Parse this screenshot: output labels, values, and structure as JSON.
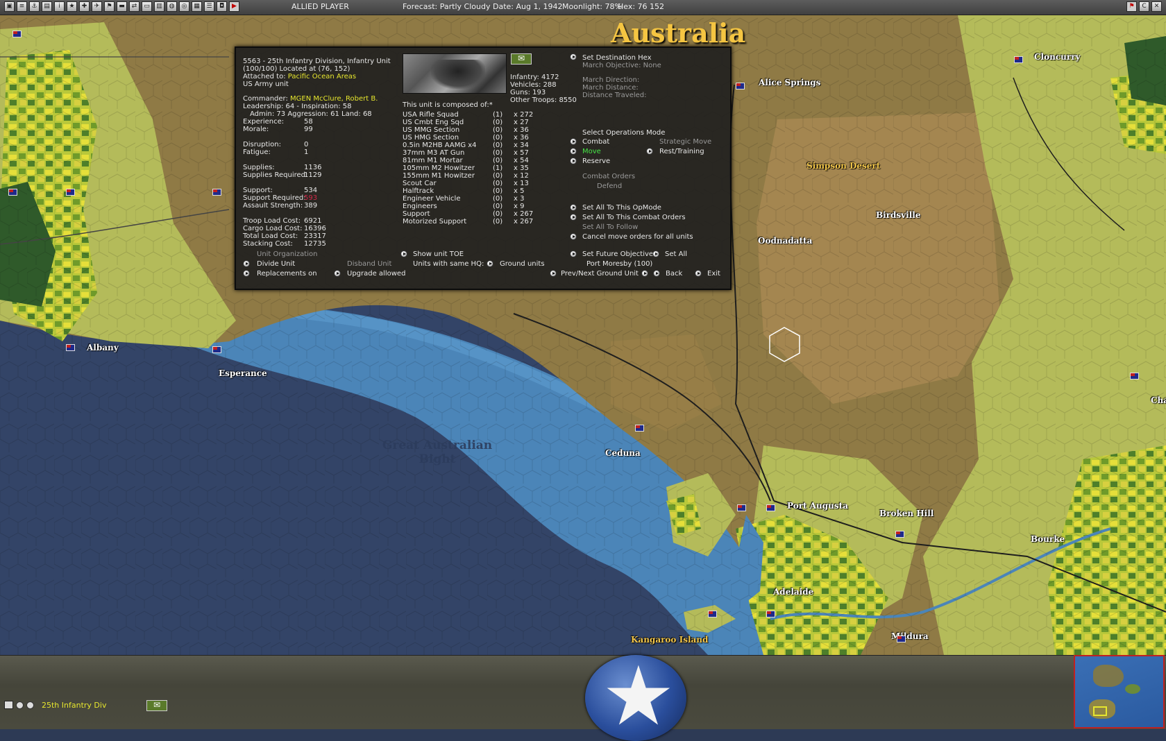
{
  "toolbar": {
    "icons": [
      "map-icon",
      "report-icon",
      "ship-icon",
      "print-icon",
      "info-icon",
      "star-icon",
      "mode-icon",
      "plane-icon",
      "flag-icon",
      "truck-icon",
      "route-icon",
      "train-icon",
      "hq-icon",
      "globe-icon",
      "supply-icon",
      "order-of-battle-icon",
      "list-icon",
      "save-icon",
      "end-turn-icon"
    ],
    "player": "ALLIED PLAYER",
    "forecast": "Forecast: Partly Cloudy",
    "date": "Date: Aug 1, 1942",
    "moonlight": "Moonlight: 78%",
    "hex": "Hex: 76 152",
    "right_icons": [
      "flag-icon",
      "c-icon",
      "close-icon"
    ]
  },
  "map": {
    "region_title": "Australia",
    "places": [
      "Alice Springs",
      "Cloncurry",
      "Simpson Desert",
      "Birdsville",
      "Oodnadatta",
      "Albany",
      "Esperance",
      "Great Australian Bight",
      "Ceduna",
      "Port Augusta",
      "Broken Hill",
      "Bourke",
      "Adelaide",
      "Kangaroo Island",
      "Mildura",
      "Charle"
    ]
  },
  "unit": {
    "header_line1": "5563 - 25th Infantry Division, Infantry Unit",
    "header_line2": "(100/100) Located at (76, 152)",
    "attached_label": "Attached to: ",
    "attached_value": "Pacific Ocean Areas",
    "unit_type": "US Army unit",
    "commander_label": "Commander: ",
    "commander_value": "MGEN McClure, Robert B.",
    "leadership": "Leadership: 64 - Inspiration: 58",
    "admin": "Admin: 73  Aggression: 61  Land: 68",
    "stats": [
      {
        "label": "Experience:",
        "value": "58"
      },
      {
        "label": "Morale:",
        "value": "99"
      },
      {
        "label": "Disruption:",
        "value": "0"
      },
      {
        "label": "Fatigue:",
        "value": "1"
      },
      {
        "label": "Supplies:",
        "value": "1136"
      },
      {
        "label": "Supplies Required:",
        "value": "1129"
      },
      {
        "label": "Support:",
        "value": "534"
      },
      {
        "label": "Support Required:",
        "value": "593"
      },
      {
        "label": "Assault Strength:",
        "value": "389"
      },
      {
        "label": "Troop Load Cost:",
        "value": "6921"
      },
      {
        "label": "Cargo Load Cost:",
        "value": "16396"
      },
      {
        "label": "Total Load Cost:",
        "value": "23317"
      },
      {
        "label": "Stacking Cost:",
        "value": "12735"
      }
    ],
    "totals": [
      "Infantry: 4172",
      "Vehicles: 288",
      "Guns: 193",
      "Other Troops: 8550"
    ],
    "composed_title": "This unit is composed of:*",
    "composition": [
      {
        "name": "USA Rifle Squad",
        "dmg": "(1)",
        "count": "x 272"
      },
      {
        "name": "US Cmbt Eng Sqd",
        "dmg": "(0)",
        "count": "x 27"
      },
      {
        "name": "US MMG Section",
        "dmg": "(0)",
        "count": "x 36"
      },
      {
        "name": "US HMG Section",
        "dmg": "(0)",
        "count": "x 36"
      },
      {
        "name": "0.5in M2HB AAMG x4",
        "dmg": "(0)",
        "count": "x 34"
      },
      {
        "name": "37mm M3 AT Gun",
        "dmg": "(0)",
        "count": "x 57"
      },
      {
        "name": "81mm M1 Mortar",
        "dmg": "(0)",
        "count": "x 54"
      },
      {
        "name": "105mm M2 Howitzer",
        "dmg": "(1)",
        "count": "x 35"
      },
      {
        "name": "155mm M1 Howitzer",
        "dmg": "(0)",
        "count": "x 12"
      },
      {
        "name": "Scout Car",
        "dmg": "(0)",
        "count": "x 13"
      },
      {
        "name": "Halftrack",
        "dmg": "(0)",
        "count": "x 5"
      },
      {
        "name": "Engineer Vehicle",
        "dmg": "(0)",
        "count": "x 3"
      },
      {
        "name": "Engineers",
        "dmg": "(0)",
        "count": "x 9"
      },
      {
        "name": "Support",
        "dmg": "(0)",
        "count": "x 267"
      },
      {
        "name": "Motorized Support",
        "dmg": "(0)",
        "count": "x 267"
      }
    ],
    "dest": {
      "set_dest": "Set Destination Hex",
      "march_objective": "March Objective: None",
      "march_direction": "March Direction:",
      "march_distance": "March Distance:",
      "distance_traveled": "Distance Traveled:"
    },
    "opmode": {
      "title": "Select Operations Mode",
      "combat": "Combat",
      "move": "Move",
      "reserve": "Reserve",
      "strategic": "Strategic Move",
      "rest": "Rest/Training",
      "combat_orders": "Combat Orders",
      "defend": "Defend"
    },
    "actions": {
      "set_all_opmode": "Set All To This OpMode",
      "set_all_combat": "Set All To This Combat Orders",
      "set_all_follow": "Set All To Follow",
      "cancel_move": "Cancel move orders for all units",
      "future_objective": "Set Future Objective",
      "set_all": "Set All",
      "port_moresby": "Port Moresby (100)",
      "unit_org": "Unit Organization",
      "divide": "Divide Unit",
      "disband": "Disband Unit",
      "replacements": "Replacements on",
      "upgrade": "Upgrade allowed",
      "show_toe": "Show unit TOE",
      "same_hq": "Units with same HQ:",
      "ground_units": "Ground units",
      "prev_next": "Prev/Next Ground Unit",
      "back": "Back",
      "exit": "Exit"
    }
  },
  "bottom": {
    "unit_name": "25th Infantry Div"
  }
}
